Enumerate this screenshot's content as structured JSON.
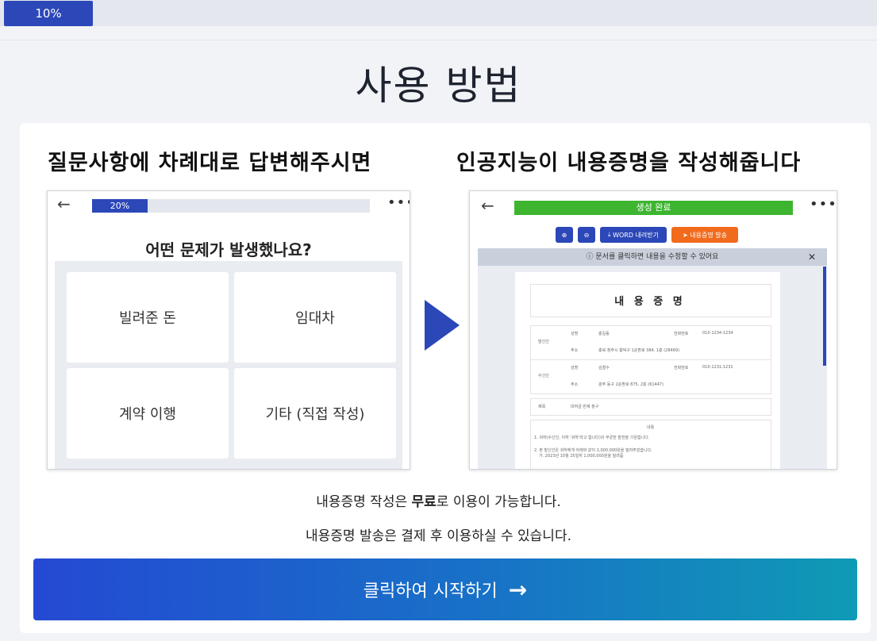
{
  "progress": {
    "label": "10%",
    "value": 0.1
  },
  "title": "사용 방법",
  "headings": {
    "left": "질문사항에 차례대로 답변해주시면",
    "right": "인공지능이 내용증명을 작성해줍니다"
  },
  "left_shot": {
    "back_icon": "arrow-left-icon",
    "progress_label": "20%",
    "more_icon": "more-icon",
    "question": "어떤 문제가 발생했나요?",
    "options": [
      "빌려준 돈",
      "임대차",
      "계약 이행",
      "기타 (직접 작성)"
    ]
  },
  "right_shot": {
    "status": "생성 완료",
    "toolbar": {
      "word_download": "WORD 내려받기",
      "send": "내용증명 발송"
    },
    "notice": "문서를 클릭하면 내용을 수정할 수 있어요",
    "document": {
      "title": "내 용 증 명",
      "sender_label": "발신인",
      "receiver_label": "수신인",
      "name_label": "성명",
      "address_label": "주소",
      "phone_label": "전화번호",
      "sender_name": "홍길동",
      "sender_phone": "010-1234-1234",
      "sender_address": "충북 청주시 흥덕구 1순환로 384, 1층 (28469)",
      "receiver_name": "김철수",
      "receiver_phone": "010-1231-1231",
      "receiver_address": "광주 동구 2순환로 875, 2층 (61447)",
      "subject_label": "제목",
      "subject": "대여금 반제 청구",
      "content_label": "내용",
      "line1": "1. 귀하(수신인, 이하 '귀하'라고 합니다)의 무궁한 발전을 기원합니다.",
      "line2": "2. 본 발신인은 귀하에게 아래와 같이 1,000,000원을 빌려주었습니다.",
      "line3": "가. 2023년 10월 25일자 1,000,000원을 빌려줌"
    }
  },
  "info": {
    "line1_pre": "내용증명 작성은 ",
    "line1_bold": "무료",
    "line1_post": "로 이용이 가능합니다.",
    "line2": "내용증명 발송은 결제 후 이용하실 수 있습니다."
  },
  "cta": {
    "label": "클릭하여 시작하기",
    "icon": "arrow-right-icon"
  },
  "colors": {
    "accent": "#2b47b8",
    "success": "#3db52f",
    "orange": "#f26a1b"
  }
}
